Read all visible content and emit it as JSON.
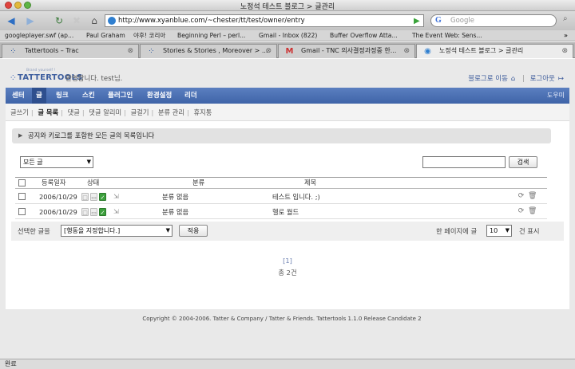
{
  "window": {
    "title": "노정석 테스트 블로그 > 글관리"
  },
  "toolbar": {
    "url": "http://www.xyanblue.com/~chester/tt/test/owner/entry",
    "search_placeholder": "Google"
  },
  "bookmarks": [
    "googleplayer.swf (ap...",
    "Paul Graham",
    "야후! 코리아",
    "Beginning Perl – perl...",
    "Gmail - Inbox (822)",
    "Buffer Overflow Atta...",
    "The Event Web: Sens..."
  ],
  "tabs": [
    {
      "label": "Tattertools – Trac"
    },
    {
      "label": "Stories & Stories , Moreover > ..."
    },
    {
      "label": "Gmail - TNC 의사결정과정중 한..."
    },
    {
      "label": "노정석 테스트 블로그 > 글관리"
    }
  ],
  "brand": {
    "tagline": "Brand yourself !",
    "logo": "TATTERTOOLS"
  },
  "welcome": "환영합니다. test님.",
  "top_links": {
    "blog": "블로그로 이동",
    "logout": "로그아웃"
  },
  "menu": {
    "items": [
      "센터",
      "글",
      "링크",
      "스킨",
      "플러그인",
      "환경설정",
      "리더"
    ],
    "help": "도우미"
  },
  "submenu": [
    "글쓰기",
    "글 목록",
    "댓글",
    "댓글 알리미",
    "글걸기",
    "분류 관리",
    "휴지통"
  ],
  "notice": "공지와 키로그를 포함한 모든 글의 목록입니다",
  "filter": {
    "selected": "모든 글",
    "search_button": "검색"
  },
  "table": {
    "headers": {
      "date": "등록일자",
      "status": "상태",
      "category": "분류",
      "title": "제목"
    },
    "rows": [
      {
        "date": "2006/10/29",
        "category": "분류 없음",
        "title": "테스트 입니다. ;)"
      },
      {
        "date": "2006/10/29",
        "category": "분류 없음",
        "title": "헬로 월드"
      }
    ]
  },
  "bulk": {
    "label": "선택한 글을",
    "action_selected": "[행동을 지정합니다.]",
    "apply": "적용",
    "per_page_label": "한 페이지에 글",
    "per_page_value": "10",
    "per_page_suffix": "건 표시"
  },
  "pagination": {
    "current": "[1]",
    "total": "총 2건"
  },
  "copyright": "Copyright © 2004-2006. Tatter & Company / Tatter & Friends.   Tattertools 1.1.0 Release Candidate 2",
  "status": "완료",
  "colors": {
    "menu_blue": "#3f64a8",
    "link_blue": "#3b5a9a",
    "status_green": "#3da03d"
  }
}
